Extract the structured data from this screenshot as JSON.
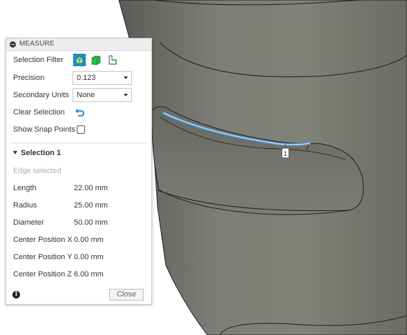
{
  "panel": {
    "title": "MEASURE",
    "rows": {
      "selection_filter": "Selection Filter",
      "precision": "Precision",
      "precision_value": "0.123",
      "secondary_units": "Secondary Units",
      "secondary_units_value": "None",
      "clear_selection": "Clear Selection",
      "show_snap_points": "Show Snap Points"
    },
    "selection": {
      "title": "Selection 1",
      "status": "Edge selected",
      "measurements": [
        {
          "label": "Length",
          "value": "22.00 mm"
        },
        {
          "label": "Radius",
          "value": "25.00 mm"
        },
        {
          "label": "Diameter",
          "value": "50.00 mm"
        },
        {
          "label": "Center Position X",
          "value": "0.00 mm"
        },
        {
          "label": "Center Position Y",
          "value": "0.00 mm"
        },
        {
          "label": "Center Position Z",
          "value": "6.00 mm"
        }
      ]
    },
    "close_label": "Close",
    "info_icon": "i"
  },
  "viewport": {
    "marker_label": "1",
    "icons": [
      "body-filter-icon",
      "face-filter-icon",
      "edge-filter-icon",
      "undo-arrow-icon",
      "info-icon"
    ]
  },
  "colors": {
    "model_gray": "#6f716a",
    "highlight_blue": "#5a9fe0",
    "filter_active_blue": "#1a8fe0",
    "filter_green": "#2db84c"
  }
}
